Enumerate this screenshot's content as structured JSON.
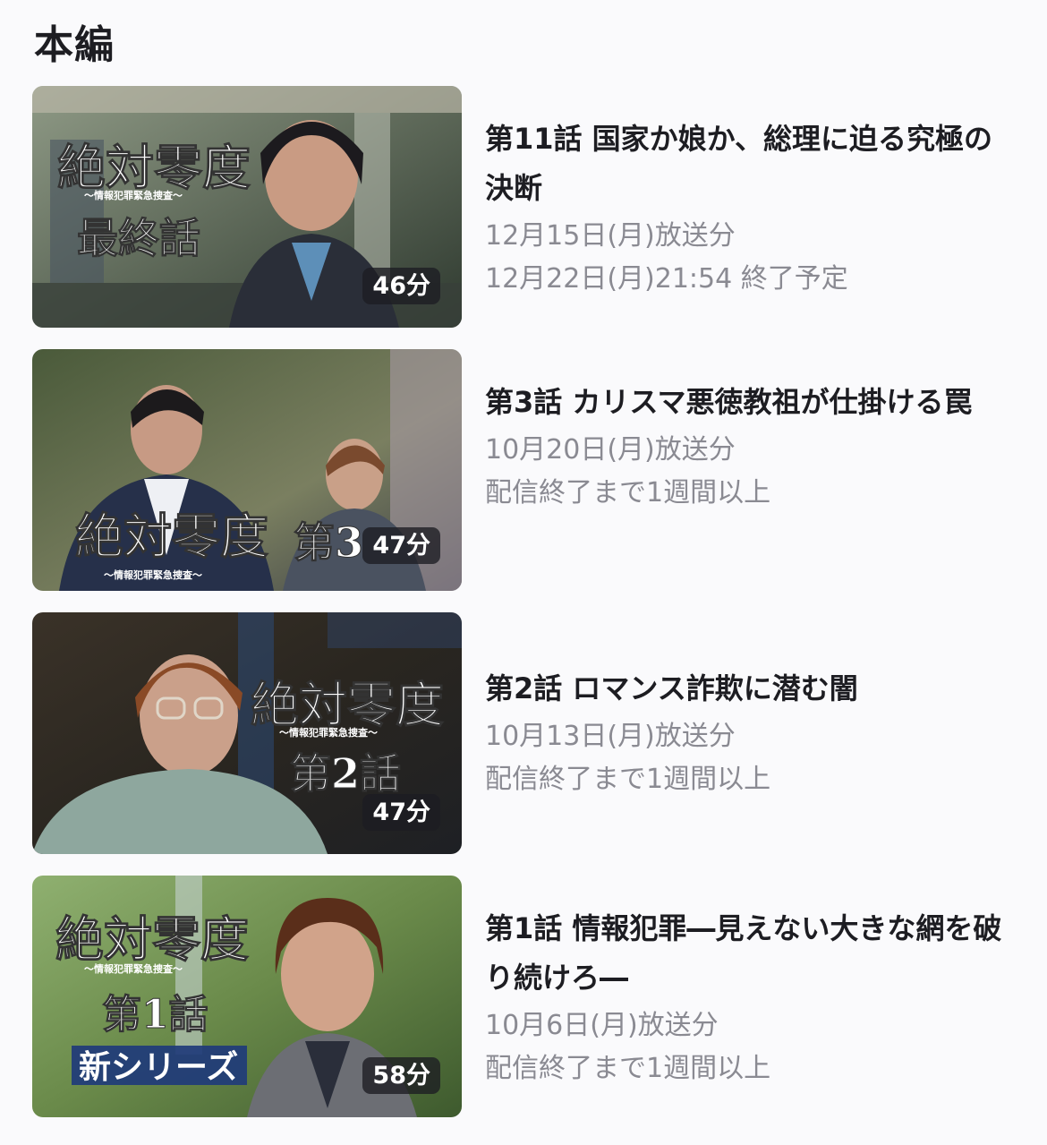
{
  "section": {
    "title": "本編"
  },
  "episodes": [
    {
      "title": "第11話 国家か娘か、総理に迫る究極の決断",
      "broadcast": "12月15日(月)放送分",
      "availability": "12月22日(月)21:54 終了予定",
      "duration": "46分",
      "thumb_lines": [
        "絶対零度",
        "〜情報犯罪緊急捜査〜",
        "最終話"
      ]
    },
    {
      "title": "第3話 カリスマ悪徳教祖が仕掛ける罠",
      "broadcast": "10月20日(月)放送分",
      "availability": "配信終了まで1週間以上",
      "duration": "47分",
      "thumb_lines": [
        "絶対零度",
        "〜情報犯罪緊急捜査〜",
        "第3"
      ]
    },
    {
      "title": "第2話 ロマンス詐欺に潜む闇",
      "broadcast": "10月13日(月)放送分",
      "availability": "配信終了まで1週間以上",
      "duration": "47分",
      "thumb_lines": [
        "絶対零度",
        "〜情報犯罪緊急捜査〜",
        "第2話"
      ]
    },
    {
      "title": "第1話 情報犯罪―見えない大きな網を破り続けろ―",
      "broadcast": "10月6日(月)放送分",
      "availability": "配信終了まで1週間以上",
      "duration": "58分",
      "thumb_lines": [
        "絶対零度",
        "〜情報犯罪緊急捜査〜",
        "第1話",
        "新シリーズ"
      ]
    }
  ]
}
